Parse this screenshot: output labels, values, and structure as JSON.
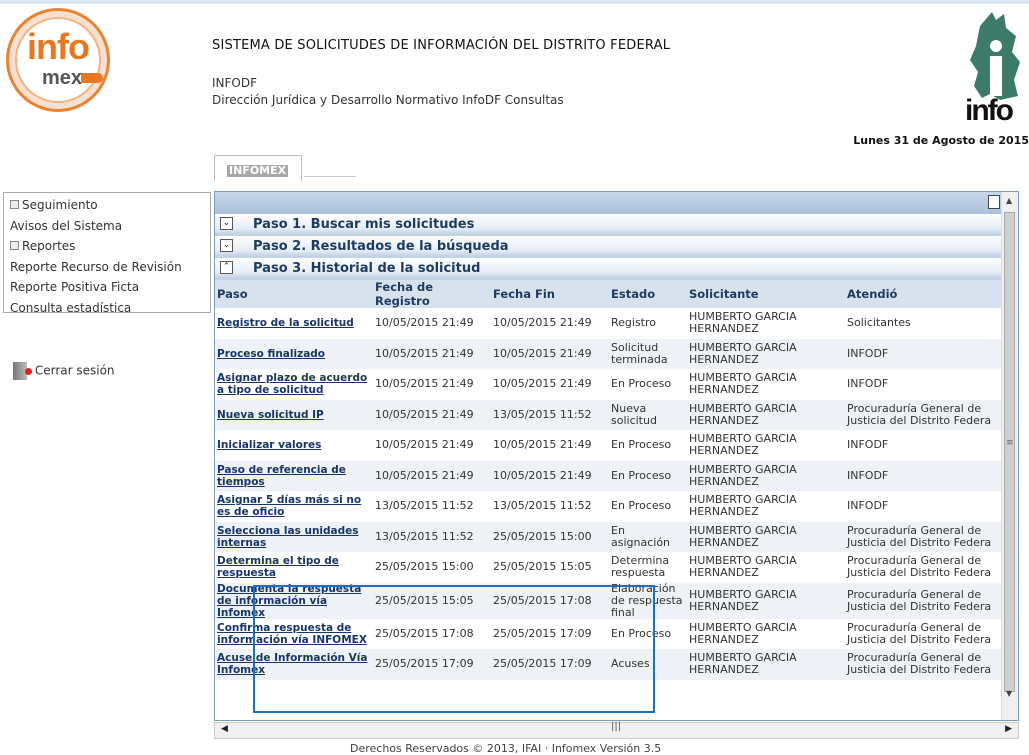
{
  "header": {
    "logo_top": "info",
    "logo_bottom": "mex",
    "system_title": "SISTEMA DE SOLICITUDES DE INFORMACIÓN DEL DISTRITO FEDERAL",
    "org": "INFODF",
    "dept": "Dirección Jurídica y Desarrollo Normativo InfoDF Consultas",
    "right_logo_text": "info",
    "date": "Lunes 31 de Agosto de 2015"
  },
  "tabs": {
    "active": "INFOMEX"
  },
  "sidebar": {
    "items": [
      {
        "label": "Seguimiento",
        "expandable": true
      },
      {
        "label": "Avisos del Sistema",
        "expandable": false
      },
      {
        "label": "Reportes",
        "expandable": true
      },
      {
        "label": "Reporte Recurso de Revisión",
        "expandable": false
      },
      {
        "label": "Reporte Positiva Ficta",
        "expandable": false
      },
      {
        "label": "Consulta estadística",
        "expandable": false
      }
    ],
    "logout": "Cerrar sesión"
  },
  "steps": [
    {
      "label": "Paso 1. Buscar mis solicitudes",
      "icon": "expand"
    },
    {
      "label": "Paso 2. Resultados de la búsqueda",
      "icon": "expand"
    },
    {
      "label": "Paso 3. Historial de la solicitud",
      "icon": "collapse"
    }
  ],
  "table": {
    "headers": [
      "Paso",
      "Fecha de Registro",
      "Fecha Fin",
      "Estado",
      "Solicitante",
      "Atendió"
    ],
    "rows": [
      [
        "Registro de la solicitud",
        "10/05/2015 21:49",
        "10/05/2015 21:49",
        "Registro",
        "HUMBERTO GARCIA HERNANDEZ",
        "Solicitantes"
      ],
      [
        "Proceso finalizado",
        "10/05/2015 21:49",
        "10/05/2015 21:49",
        "Solicitud terminada",
        "HUMBERTO GARCIA HERNANDEZ",
        "INFODF"
      ],
      [
        "Asignar plazo de acuerdo a tipo de solicitud",
        "10/05/2015 21:49",
        "10/05/2015 21:49",
        "En Proceso",
        "HUMBERTO GARCIA HERNANDEZ",
        "INFODF"
      ],
      [
        "Nueva solicitud IP",
        "10/05/2015 21:49",
        "13/05/2015 11:52",
        "Nueva solicitud",
        "HUMBERTO GARCIA HERNANDEZ",
        "Procuraduría General de Justicia del Distrito Federa"
      ],
      [
        "Inicializar valores",
        "10/05/2015 21:49",
        "10/05/2015 21:49",
        "En Proceso",
        "HUMBERTO GARCIA HERNANDEZ",
        "INFODF"
      ],
      [
        "Paso de referencia de tiempos",
        "10/05/2015 21:49",
        "10/05/2015 21:49",
        "En Proceso",
        "HUMBERTO GARCIA HERNANDEZ",
        "INFODF"
      ],
      [
        "Asignar 5 días más si no es de oficio",
        "13/05/2015 11:52",
        "13/05/2015 11:52",
        "En Proceso",
        "HUMBERTO GARCIA HERNANDEZ",
        "INFODF"
      ],
      [
        "Selecciona las unidades internas",
        "13/05/2015 11:52",
        "25/05/2015 15:00",
        "En asignación",
        "HUMBERTO GARCIA HERNANDEZ",
        "Procuraduría General de Justicia del Distrito Federa"
      ],
      [
        "Determina el tipo de respuesta",
        "25/05/2015 15:00",
        "25/05/2015 15:05",
        "Determina respuesta",
        "HUMBERTO GARCIA HERNANDEZ",
        "Procuraduría General de Justicia del Distrito Federa"
      ],
      [
        "Documenta la respuesta de información vía Infomex",
        "25/05/2015 15:05",
        "25/05/2015 17:08",
        "Elaboración de respuesta final",
        "HUMBERTO GARCIA HERNANDEZ",
        "Procuraduría General de Justicia del Distrito Federa"
      ],
      [
        "Confirma respuesta de información vía INFOMEX",
        "25/05/2015 17:08",
        "25/05/2015 17:09",
        "En Proceso",
        "HUMBERTO GARCIA HERNANDEZ",
        "Procuraduría General de Justicia del Distrito Federa"
      ],
      [
        "Acuse de Información Vía Infomex",
        "25/05/2015 17:09",
        "25/05/2015 17:09",
        "Acuses",
        "HUMBERTO GARCIA HERNANDEZ",
        "Procuraduría General de Justicia del Distrito Federa"
      ]
    ]
  },
  "footer": "Derechos Reservados © 2013, IFAI · Infomex Versión 3.5",
  "colors": {
    "accent": "#e87722",
    "link": "#17356a",
    "header_bg": "#d8e2ee",
    "highlight": "#1f6fbf"
  }
}
